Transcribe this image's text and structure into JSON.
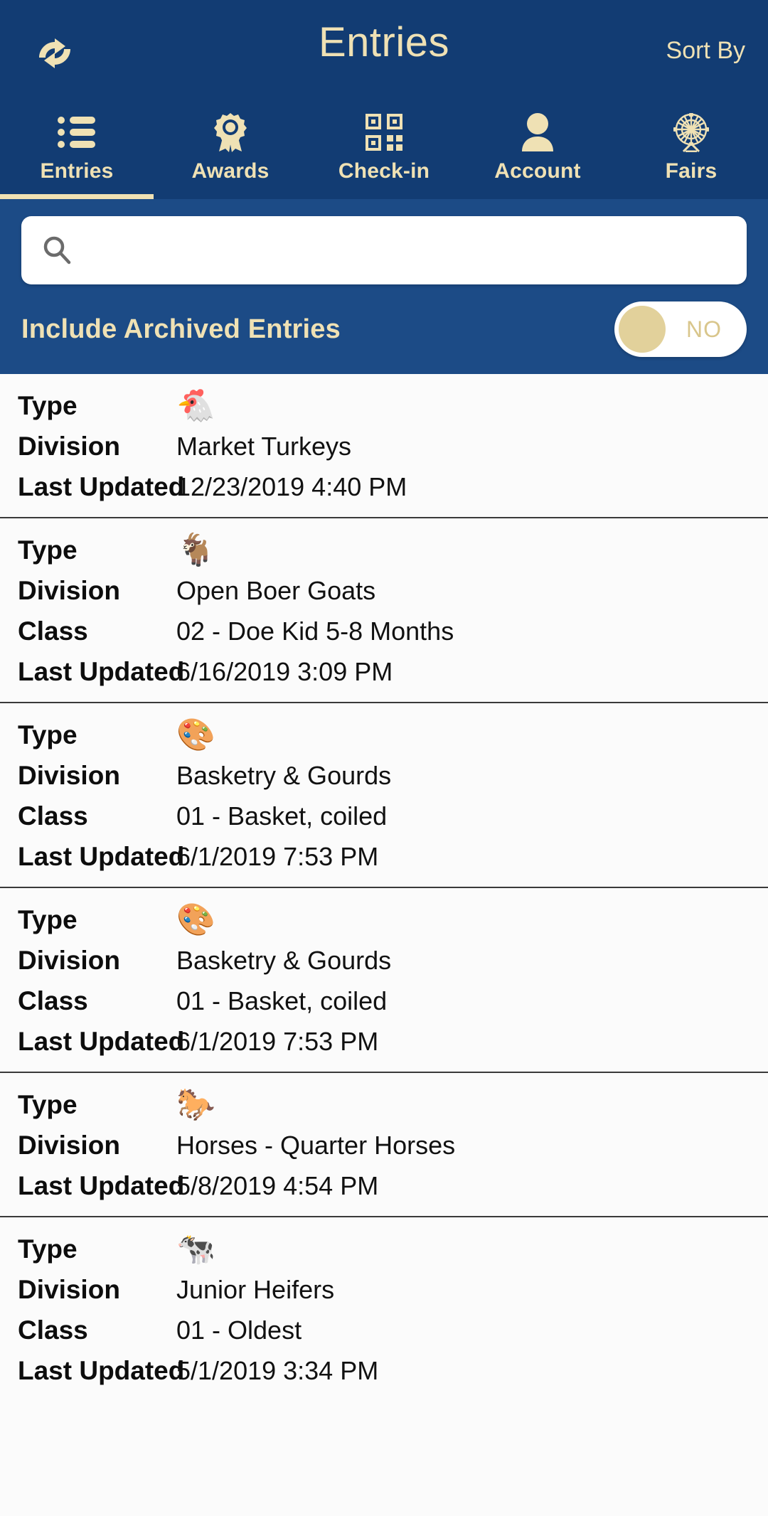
{
  "header": {
    "title": "Entries",
    "refresh_icon": "refresh-sync-icon",
    "sort_by_label": "Sort By",
    "background_color": "#123C73",
    "accent_color": "#EFE1B4"
  },
  "tabs": [
    {
      "label": "Entries",
      "icon": "list-icon",
      "active": true
    },
    {
      "label": "Awards",
      "icon": "award-ribbon-icon",
      "active": false
    },
    {
      "label": "Check-in",
      "icon": "qr-code-icon",
      "active": false
    },
    {
      "label": "Account",
      "icon": "person-icon",
      "active": false
    },
    {
      "label": "Fairs",
      "icon": "ferris-wheel-icon",
      "active": false
    }
  ],
  "search": {
    "value": "",
    "placeholder": "",
    "icon": "search-icon"
  },
  "archive_filter": {
    "label": "Include Archived Entries",
    "toggle_value": "NO",
    "toggle_on": false,
    "panel_color": "#1C4B86"
  },
  "labels": {
    "type": "Type",
    "division": "Division",
    "class": "Class",
    "last_updated": "Last Updated"
  },
  "entries": [
    {
      "type_icon": "chicken-icon",
      "type_emoji": "🐔",
      "division": "Market Turkeys",
      "class": null,
      "last_updated": "12/23/2019 4:40 PM"
    },
    {
      "type_icon": "goat-icon",
      "type_emoji": "🐐",
      "division": "Open Boer Goats",
      "class": "02 - Doe Kid 5-8 Months",
      "last_updated": "6/16/2019 3:09 PM"
    },
    {
      "type_icon": "framed-picture-easel-icon",
      "type_emoji": "🎨",
      "division": "Basketry & Gourds",
      "class": "01 - Basket, coiled",
      "last_updated": "6/1/2019 7:53 PM"
    },
    {
      "type_icon": "framed-picture-easel-icon",
      "type_emoji": "🎨",
      "division": "Basketry & Gourds",
      "class": "01 - Basket, coiled",
      "last_updated": "6/1/2019 7:53 PM"
    },
    {
      "type_icon": "horse-icon",
      "type_emoji": "🐎",
      "division": "Horses - Quarter Horses",
      "class": null,
      "last_updated": "5/8/2019 4:54 PM"
    },
    {
      "type_icon": "cow-icon",
      "type_emoji": "🐄",
      "division": "Junior Heifers",
      "class": "01 - Oldest",
      "last_updated": "5/1/2019 3:34 PM"
    }
  ]
}
